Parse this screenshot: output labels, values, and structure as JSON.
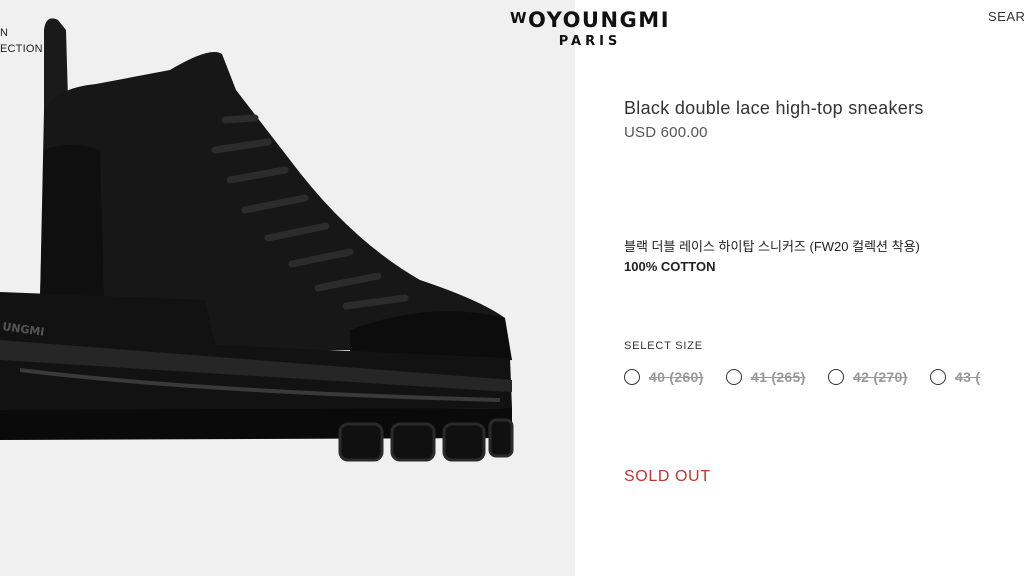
{
  "nav": {
    "items": [
      "N",
      "ECTION"
    ]
  },
  "logo": {
    "main_prefix": "W",
    "main_rest": "OYOUNGMI",
    "sub": "PARIS"
  },
  "header": {
    "search_label": "SEAR"
  },
  "product": {
    "name": "Black double lace high-top sneakers",
    "price": "USD 600.00",
    "description_ko": "블랙 더블 레이스 하이탑 스니커즈 (FW20 컬렉션 착용)",
    "material": "100% COTTON",
    "image_sole_text": "UNGMI",
    "size_label": "SELECT SIZE",
    "sizes": [
      {
        "label": "40 (260)",
        "available": false
      },
      {
        "label": "41 (265)",
        "available": false
      },
      {
        "label": "42 (270)",
        "available": false
      },
      {
        "label": "43 (",
        "available": false
      }
    ],
    "status": "SOLD OUT"
  },
  "colors": {
    "image_background": "#f0f0f0",
    "sold_out": "#c0362c",
    "unavailable_size_text": "#999999"
  }
}
